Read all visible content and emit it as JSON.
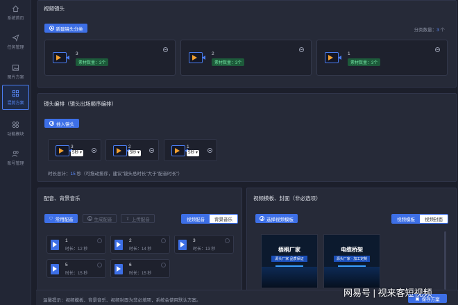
{
  "sidebar": {
    "items": [
      {
        "label": "系统首页",
        "icon": "home-icon"
      },
      {
        "label": "任务管理",
        "icon": "send-icon"
      },
      {
        "label": "图片方案",
        "icon": "image-icon"
      },
      {
        "label": "混剪方案",
        "icon": "grid-icon",
        "active": true
      },
      {
        "label": "功能模块",
        "icon": "modules-icon"
      },
      {
        "label": "账号管理",
        "icon": "users-icon"
      }
    ]
  },
  "lens": {
    "title": "视频镜头",
    "new_button": "新建镜头分类",
    "count_label": "分类数量：",
    "count_value": "3",
    "count_unit": "个",
    "cards": [
      {
        "num": "3",
        "badge": "素材数量：3个"
      },
      {
        "num": "2",
        "badge": "素材数量：3个"
      },
      {
        "num": "1",
        "badge": "素材数量：3个"
      }
    ]
  },
  "arrange": {
    "title": "镜头编排（镜头出场顺序编排）",
    "insert_button": "插入镜头",
    "items": [
      {
        "num": "3",
        "dur": "5秒"
      },
      {
        "num": "2",
        "dur": "5秒"
      },
      {
        "num": "1",
        "dur": "5秒"
      }
    ],
    "total_prefix": "时长总计：",
    "total_value": "15",
    "total_suffix": "秒（可拖动排序，建议\"镜头总时长\"大于\"配音时长\"）"
  },
  "audio": {
    "title": "配音、背景音乐",
    "btn_common": "常用配音",
    "btn_generate": "生成配音",
    "btn_upload": "上传配音",
    "tab_voice": "视频配音",
    "tab_bgm": "背景音乐",
    "items": [
      {
        "num": "1",
        "dur": "时长：12 秒"
      },
      {
        "num": "2",
        "dur": "时长：14 秒"
      },
      {
        "num": "3",
        "dur": "时长：13 秒"
      },
      {
        "num": "5",
        "dur": "时长：15 秒"
      },
      {
        "num": "6",
        "dur": "时长：15 秒"
      }
    ]
  },
  "template": {
    "title": "视频模板、封面（非必选项）",
    "select_button": "选择视频模板",
    "tab_template": "视频模板",
    "tab_cover": "视频封面",
    "thumbs": [
      {
        "title": "梧桐厂家",
        "sub": "源头厂家 品质保证"
      },
      {
        "title": "电缆桥架",
        "sub": "源头厂家 · 加工定制"
      }
    ]
  },
  "footer": {
    "hint": "温馨提示：视频模板、背景音乐、视频封面为非必填项，系统会使用默认方案。",
    "save_button": "保存方案"
  },
  "watermark": "网易号 | 视来客短视频",
  "colors": {
    "accent": "#3d6fe6",
    "badge_bg": "#1d5a3a",
    "badge_text": "#6fe0a0"
  }
}
